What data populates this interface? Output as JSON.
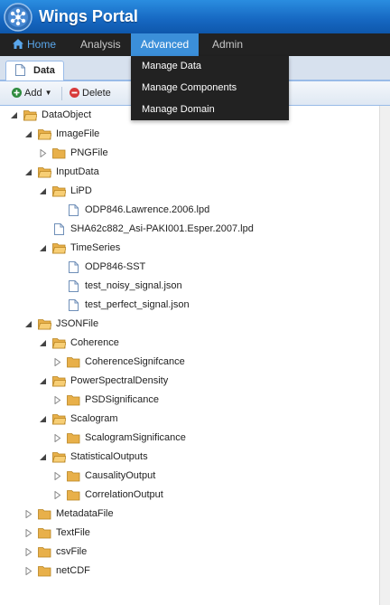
{
  "app": {
    "title": "Wings Portal"
  },
  "nav": {
    "home": "Home",
    "analysis": "Analysis",
    "advanced": "Advanced",
    "admin": "Admin"
  },
  "dropdown": {
    "items": [
      "Manage Data",
      "Manage Components",
      "Manage Domain"
    ]
  },
  "tab": {
    "label": "Data"
  },
  "toolbar": {
    "add": "Add",
    "delete": "Delete"
  },
  "tree": [
    {
      "label": "DataObject",
      "depth": 0,
      "type": "folder",
      "state": "expanded"
    },
    {
      "label": "ImageFile",
      "depth": 1,
      "type": "folder",
      "state": "expanded"
    },
    {
      "label": "PNGFile",
      "depth": 2,
      "type": "folder",
      "state": "collapsed"
    },
    {
      "label": "InputData",
      "depth": 1,
      "type": "folder",
      "state": "expanded"
    },
    {
      "label": "LiPD",
      "depth": 2,
      "type": "folder",
      "state": "expanded"
    },
    {
      "label": "ODP846.Lawrence.2006.lpd",
      "depth": 3,
      "type": "file",
      "state": "leaf"
    },
    {
      "label": "SHA62c882_Asi-PAKI001.Esper.2007.lpd",
      "depth": 2,
      "type": "file",
      "state": "leaf"
    },
    {
      "label": "TimeSeries",
      "depth": 2,
      "type": "folder",
      "state": "expanded"
    },
    {
      "label": "ODP846-SST",
      "depth": 3,
      "type": "file",
      "state": "leaf"
    },
    {
      "label": "test_noisy_signal.json",
      "depth": 3,
      "type": "file",
      "state": "leaf"
    },
    {
      "label": "test_perfect_signal.json",
      "depth": 3,
      "type": "file",
      "state": "leaf"
    },
    {
      "label": "JSONFile",
      "depth": 1,
      "type": "folder",
      "state": "expanded"
    },
    {
      "label": "Coherence",
      "depth": 2,
      "type": "folder",
      "state": "expanded"
    },
    {
      "label": "CoherenceSignifcance",
      "depth": 3,
      "type": "folder",
      "state": "collapsed"
    },
    {
      "label": "PowerSpectralDensity",
      "depth": 2,
      "type": "folder",
      "state": "expanded"
    },
    {
      "label": "PSDSignificance",
      "depth": 3,
      "type": "folder",
      "state": "collapsed"
    },
    {
      "label": "Scalogram",
      "depth": 2,
      "type": "folder",
      "state": "expanded"
    },
    {
      "label": "ScalogramSignificance",
      "depth": 3,
      "type": "folder",
      "state": "collapsed"
    },
    {
      "label": "StatisticalOutputs",
      "depth": 2,
      "type": "folder",
      "state": "expanded"
    },
    {
      "label": "CausalityOutput",
      "depth": 3,
      "type": "folder",
      "state": "collapsed"
    },
    {
      "label": "CorrelationOutput",
      "depth": 3,
      "type": "folder",
      "state": "collapsed"
    },
    {
      "label": "MetadataFile",
      "depth": 1,
      "type": "folder",
      "state": "collapsed"
    },
    {
      "label": "TextFile",
      "depth": 1,
      "type": "folder",
      "state": "collapsed"
    },
    {
      "label": "csvFile",
      "depth": 1,
      "type": "folder",
      "state": "collapsed"
    },
    {
      "label": "netCDF",
      "depth": 1,
      "type": "folder",
      "state": "collapsed"
    }
  ],
  "colors": {
    "header": "#1667c1",
    "navbar": "#222222",
    "nav_active": "#3b8fd9",
    "folder": "#e8b04a",
    "add_icon": "#2e8b3e",
    "delete_icon": "#d83a3a"
  }
}
